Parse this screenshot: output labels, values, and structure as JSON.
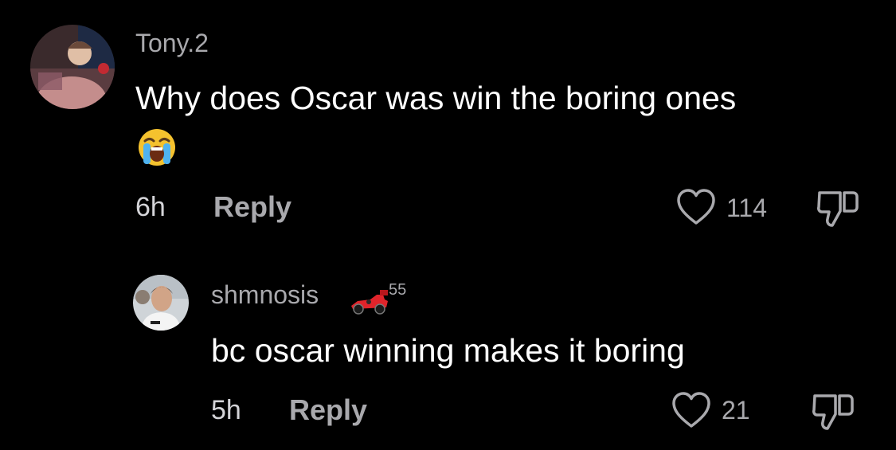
{
  "comment": {
    "username": "Tony.2",
    "text": "Why does Oscar was win the boring ones",
    "emoji": "loudly-crying-face",
    "time": "6h",
    "reply_label": "Reply",
    "like_count": "114"
  },
  "reply": {
    "username": "shmnosis",
    "badge_emoji": "racing-car",
    "badge_number": "55",
    "text": "bc oscar winning makes it boring",
    "time": "5h",
    "reply_label": "Reply",
    "like_count": "21"
  },
  "colors": {
    "background": "#000000",
    "username": "#a9a9ad",
    "text": "#ffffff",
    "accent_red": "#e0242b"
  }
}
